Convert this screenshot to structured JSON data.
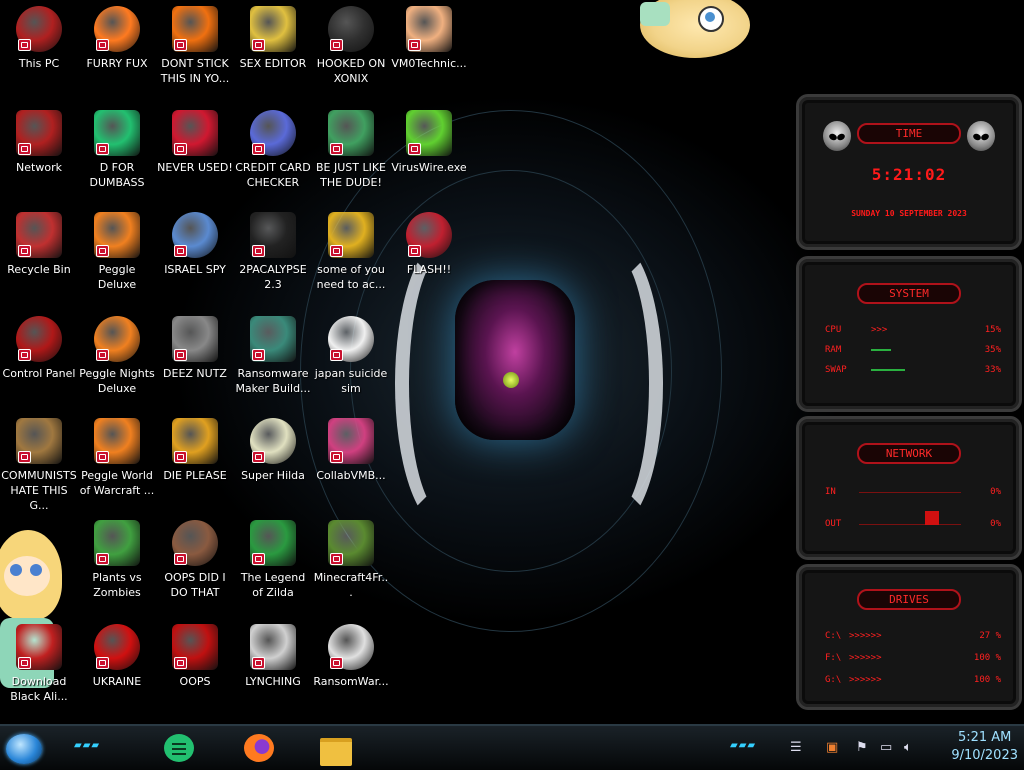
{
  "desktop": {
    "icons": [
      {
        "label": "This PC",
        "col": 0,
        "row": 0,
        "icon": "computer-icon",
        "color": "#b02020"
      },
      {
        "label": "Network",
        "col": 0,
        "row": 1,
        "icon": "network-icon",
        "color": "#b02020"
      },
      {
        "label": "Recycle Bin",
        "col": 0,
        "row": 2,
        "icon": "recycle-bin-icon",
        "color": "#c03030"
      },
      {
        "label": "Control Panel",
        "col": 0,
        "row": 3,
        "icon": "control-panel-icon",
        "color": "#b01818"
      },
      {
        "label": "COMMUNISTS HATE THIS G...",
        "col": 0,
        "row": 4,
        "icon": "money-bag-icon",
        "color": "#a07840"
      },
      {
        "label": "Download Black Ali...",
        "col": 0,
        "row": 6,
        "icon": "download-icon",
        "color": "#c02020"
      },
      {
        "label": "FURRY FUX",
        "col": 1,
        "row": 0,
        "icon": "firefox-icon",
        "color": "#ff7a20"
      },
      {
        "label": "D FOR DUMBASS",
        "col": 1,
        "row": 1,
        "icon": "discord-style-icon",
        "color": "#22c070"
      },
      {
        "label": "Peggle Deluxe",
        "col": 1,
        "row": 2,
        "icon": "peggle-icon",
        "color": "#f08020"
      },
      {
        "label": "Peggle Nights Deluxe",
        "col": 1,
        "row": 3,
        "icon": "peggle-icon",
        "color": "#f08020"
      },
      {
        "label": "Peggle World of Warcraft ...",
        "col": 1,
        "row": 4,
        "icon": "peggle-icon",
        "color": "#f08020"
      },
      {
        "label": "Plants vs Zombies",
        "col": 1,
        "row": 5,
        "icon": "plant-icon",
        "color": "#40a040"
      },
      {
        "label": "UKRAINE",
        "col": 1,
        "row": 6,
        "icon": "radiation-icon",
        "color": "#d01010"
      },
      {
        "label": "DONT STICK THIS IN YO...",
        "col": 2,
        "row": 0,
        "icon": "vlc-cone-icon",
        "color": "#f07010"
      },
      {
        "label": "NEVER USED!",
        "col": 2,
        "row": 1,
        "icon": "dev-cpp-icon",
        "color": "#d01830"
      },
      {
        "label": "ISRAEL SPY",
        "col": 2,
        "row": 2,
        "icon": "remote-desktop-icon",
        "color": "#5a8ad0"
      },
      {
        "label": "DEEZ NUTZ",
        "col": 2,
        "row": 3,
        "icon": "stacked-windows-icon",
        "color": "#888888"
      },
      {
        "label": "DIE PLEASE",
        "col": 2,
        "row": 4,
        "icon": "delphi-de-icon",
        "color": "#e0a020"
      },
      {
        "label": "OOPS DID I DO THAT",
        "col": 2,
        "row": 5,
        "icon": "portrait-icon",
        "color": "#8a5a40"
      },
      {
        "label": "OOPS",
        "col": 2,
        "row": 6,
        "icon": "alien-laptop-icon",
        "color": "#c01010"
      },
      {
        "label": "SEX EDITOR",
        "col": 3,
        "row": 0,
        "icon": "hxd-editor-icon",
        "color": "#e0c040"
      },
      {
        "label": "CREDIT CARD CHECKER",
        "col": 3,
        "row": 1,
        "icon": "credit-card-icon",
        "color": "#5a6ad8"
      },
      {
        "label": "2PACALYPSE 2.3",
        "col": 3,
        "row": 2,
        "icon": "terminal-icon",
        "color": "#222222"
      },
      {
        "label": "Ransomware Maker Build...",
        "col": 3,
        "row": 3,
        "icon": "window-app-icon",
        "color": "#3a8a7a"
      },
      {
        "label": "Super Hilda",
        "col": 3,
        "row": 4,
        "icon": "pixel-cat-icon",
        "color": "#e0e0c0"
      },
      {
        "label": "The Legend of Zilda",
        "col": 3,
        "row": 5,
        "icon": "pixel-hero-icon",
        "color": "#2a9a40"
      },
      {
        "label": "LYNCHING",
        "col": 3,
        "row": 6,
        "icon": "gear-shield-icon",
        "color": "#d0d0d0"
      },
      {
        "label": "HOOKED ON XONIX",
        "col": 4,
        "row": 0,
        "icon": "xonix-icon",
        "color": "#303030"
      },
      {
        "label": "BE JUST LIKE THE DUDE!",
        "col": 4,
        "row": 1,
        "icon": "elf-face-icon",
        "color": "#40a060"
      },
      {
        "label": "some of you need to ac...",
        "col": 4,
        "row": 2,
        "icon": "dog-icon",
        "color": "#e0b020"
      },
      {
        "label": "japan suicide sim",
        "col": 4,
        "row": 3,
        "icon": "document-icon",
        "color": "#f0f0f0"
      },
      {
        "label": "CollabVMB...",
        "col": 4,
        "row": 4,
        "icon": "monitor-icon",
        "color": "#d04080"
      },
      {
        "label": "Minecraft4Fr...",
        "col": 4,
        "row": 5,
        "icon": "grass-block-icon",
        "color": "#5a8a30"
      },
      {
        "label": "RansomWar...",
        "col": 4,
        "row": 6,
        "icon": "skull-icon",
        "color": "#e0e0e0"
      },
      {
        "label": "VM0Technic...",
        "col": 5,
        "row": 0,
        "icon": "doctor-icon",
        "color": "#f0b080"
      },
      {
        "label": "VirusWire.exe",
        "col": 5,
        "row": 1,
        "icon": "limewire-icon",
        "color": "#60d030"
      },
      {
        "label": "FLASH!!",
        "col": 5,
        "row": 2,
        "icon": "flash-document-icon",
        "color": "#c02030"
      }
    ]
  },
  "gadgets": {
    "time": {
      "title": "TIME",
      "clock": "5:21:02",
      "date": "SUNDAY 10 SEPTEMBER 2023"
    },
    "system": {
      "title": "SYSTEM",
      "rows": [
        {
          "key": "CPU",
          "value": "15%",
          "level": 0.15,
          "indicator": ">>>"
        },
        {
          "key": "RAM",
          "value": "35%",
          "level": 0.35
        },
        {
          "key": "SWAP",
          "value": "33%",
          "level": 0.33
        }
      ]
    },
    "network": {
      "title": "NETWORK",
      "rows": [
        {
          "key": "IN",
          "value": "0%"
        },
        {
          "key": "OUT",
          "value": "0%"
        }
      ]
    },
    "drives": {
      "title": "DRIVES",
      "rows": [
        {
          "key": "C:\\",
          "value": "27 %",
          "indicator": ">>>>>>"
        },
        {
          "key": "F:\\",
          "value": "100 %",
          "indicator": ">>>>>>"
        },
        {
          "key": "G:\\",
          "value": "100 %",
          "indicator": ">>>>>>"
        }
      ]
    }
  },
  "taskbar": {
    "apps": [
      {
        "name": "discord-style-app",
        "icon": "discord-style-icon",
        "color": "#22c070"
      },
      {
        "name": "firefox-app",
        "icon": "firefox-icon",
        "color": "#ff7a20"
      },
      {
        "name": "file-explorer-app",
        "icon": "folder-icon",
        "color": "#f0c040"
      }
    ],
    "clock": {
      "time": "5:21 AM",
      "date": "9/10/2023"
    }
  }
}
